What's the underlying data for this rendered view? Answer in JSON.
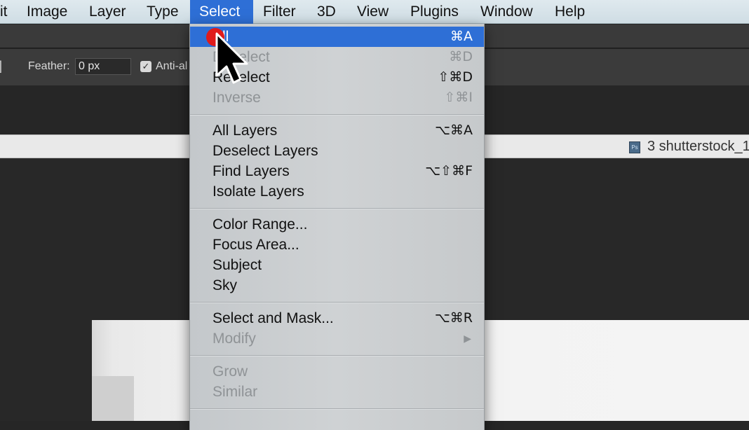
{
  "menubar": {
    "items": [
      {
        "label": "it"
      },
      {
        "label": "Image"
      },
      {
        "label": "Layer"
      },
      {
        "label": "Type"
      },
      {
        "label": "Select"
      },
      {
        "label": "Filter"
      },
      {
        "label": "3D"
      },
      {
        "label": "View"
      },
      {
        "label": "Plugins"
      },
      {
        "label": "Window"
      },
      {
        "label": "Help"
      }
    ],
    "active": "Select"
  },
  "options_bar": {
    "bracket": "]",
    "feather_label": "Feather:",
    "feather_value": "0 px",
    "anti_alias_label": "Anti-al",
    "anti_alias_checked": true
  },
  "document": {
    "tab_name": "3 shutterstock_1",
    "icon": "ps-file-icon"
  },
  "select_menu": {
    "groups": [
      [
        {
          "label": "All",
          "shortcut": "⌘A",
          "state": "highlighted"
        },
        {
          "label": "Deselect",
          "shortcut": "⌘D",
          "state": "disabled"
        },
        {
          "label": "Reselect",
          "shortcut": "⇧⌘D",
          "state": "enabled"
        },
        {
          "label": "Inverse",
          "shortcut": "⇧⌘I",
          "state": "disabled"
        }
      ],
      [
        {
          "label": "All Layers",
          "shortcut": "⌥⌘A",
          "state": "enabled"
        },
        {
          "label": "Deselect Layers",
          "shortcut": "",
          "state": "enabled"
        },
        {
          "label": "Find Layers",
          "shortcut": "⌥⇧⌘F",
          "state": "enabled"
        },
        {
          "label": "Isolate Layers",
          "shortcut": "",
          "state": "enabled"
        }
      ],
      [
        {
          "label": "Color Range...",
          "shortcut": "",
          "state": "enabled"
        },
        {
          "label": "Focus Area...",
          "shortcut": "",
          "state": "enabled"
        },
        {
          "label": "Subject",
          "shortcut": "",
          "state": "enabled"
        },
        {
          "label": "Sky",
          "shortcut": "",
          "state": "enabled"
        }
      ],
      [
        {
          "label": "Select and Mask...",
          "shortcut": "⌥⌘R",
          "state": "enabled"
        },
        {
          "label": "Modify",
          "shortcut": "",
          "state": "disabled",
          "submenu": true
        }
      ],
      [
        {
          "label": "Grow",
          "shortcut": "",
          "state": "disabled"
        },
        {
          "label": "Similar",
          "shortcut": "",
          "state": "disabled"
        }
      ]
    ],
    "submenu_glyph": "▶"
  },
  "colors": {
    "menu_highlight": "#2e6fd6",
    "click_indicator": "#e01b1b"
  }
}
